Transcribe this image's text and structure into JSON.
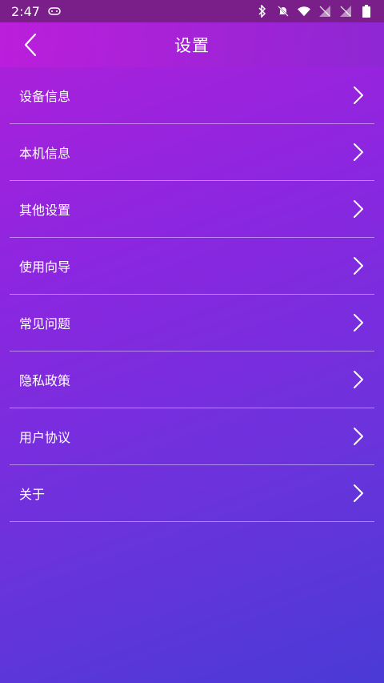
{
  "status_bar": {
    "time": "2:47",
    "icons": [
      "gamepad-icon",
      "bluetooth-icon",
      "mute-icon",
      "wifi-icon",
      "no-signal-icon",
      "no-signal-icon",
      "battery-icon"
    ]
  },
  "header": {
    "title": "设置"
  },
  "menu": {
    "items": [
      {
        "label": "设备信息"
      },
      {
        "label": "本机信息"
      },
      {
        "label": "其他设置"
      },
      {
        "label": "使用向导"
      },
      {
        "label": "常见问题"
      },
      {
        "label": "隐私政策"
      },
      {
        "label": "用户协议"
      },
      {
        "label": "关于"
      }
    ]
  },
  "colors": {
    "gradient_start": "#b21fd8",
    "gradient_end": "#4a3ad6",
    "status_bar_bg": "#7a1f8a"
  }
}
